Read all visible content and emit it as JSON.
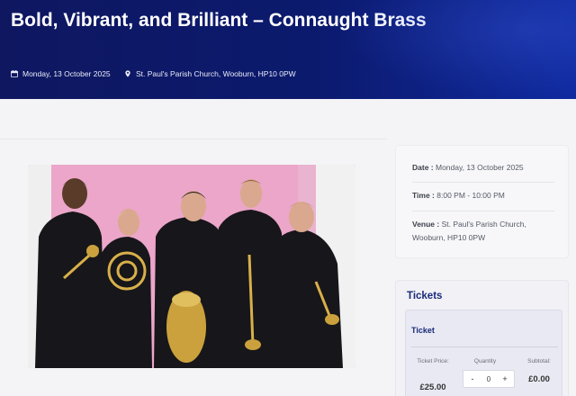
{
  "event": {
    "title": "Bold, Vibrant, and Brilliant – Connaught Brass",
    "date": "Monday, 13 October 2025",
    "venue": "St. Paul's Parish Church, Wooburn, HP10 0PW"
  },
  "details": {
    "date_label": "Date :",
    "date_value": "Monday, 13 October 2025",
    "time_label": "Time :",
    "time_value": "8:00 PM - 10:00 PM",
    "venue_label": "Venue :",
    "venue_value": "St. Paul's Parish Church, Wooburn, HP10 0PW"
  },
  "tickets": {
    "heading": "Tickets",
    "ticket_label": "Ticket",
    "price_header": "Ticket Price:",
    "quantity_header": "Quantity",
    "subtotal_header": "Subtotal:",
    "price": "£25.00",
    "quantity": "0",
    "minus": "-",
    "plus": "+",
    "subtotal": "£0.00"
  },
  "icons": {
    "calendar": "calendar-icon",
    "location": "location-pin-icon"
  },
  "colors": {
    "hero_bg": "#0c1a6e",
    "accent": "#1a2a7a",
    "photo_bg": "#e8a7c7"
  }
}
